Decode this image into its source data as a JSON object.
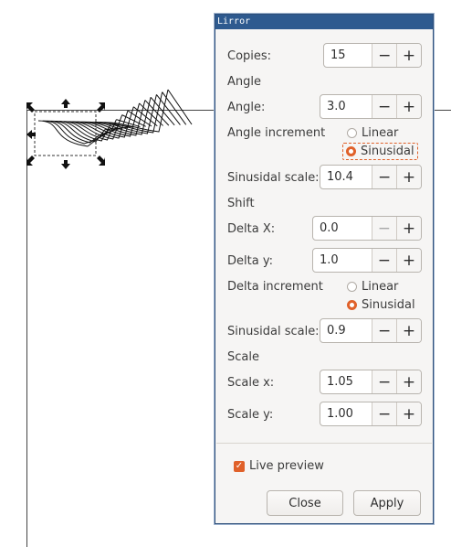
{
  "dialog": {
    "title": "Lirror",
    "copies": {
      "label": "Copies:",
      "value": "15"
    },
    "angle_section": "Angle",
    "angle": {
      "label": "Angle:",
      "value": "3.0"
    },
    "angle_increment": {
      "label": "Angle increment",
      "opt_linear": "Linear",
      "opt_sinusoidal": "Sinusidal",
      "selected": "Sinusidal"
    },
    "angle_sin_scale": {
      "label": "Sinusidal scale:",
      "value": "10.4"
    },
    "shift_section": "Shift",
    "delta_x": {
      "label": "Delta X:",
      "value": "0.0"
    },
    "delta_y": {
      "label": "Delta y:",
      "value": "1.0"
    },
    "delta_increment": {
      "label": "Delta increment",
      "opt_linear": "Linear",
      "opt_sinusoidal": "Sinusidal",
      "selected": "Sinusidal"
    },
    "delta_sin_scale": {
      "label": "Sinusidal scale:",
      "value": "0.9"
    },
    "scale_section": "Scale",
    "scale_x": {
      "label": "Scale x:",
      "value": "1.05"
    },
    "scale_y": {
      "label": "Scale y:",
      "value": "1.00"
    },
    "live_preview": {
      "label": "Live preview",
      "checked": true
    },
    "close_label": "Close",
    "apply_label": "Apply",
    "minus": "−",
    "plus": "+"
  },
  "colors": {
    "accent": "#e0612a",
    "titlebar": "#2e5a8f"
  }
}
